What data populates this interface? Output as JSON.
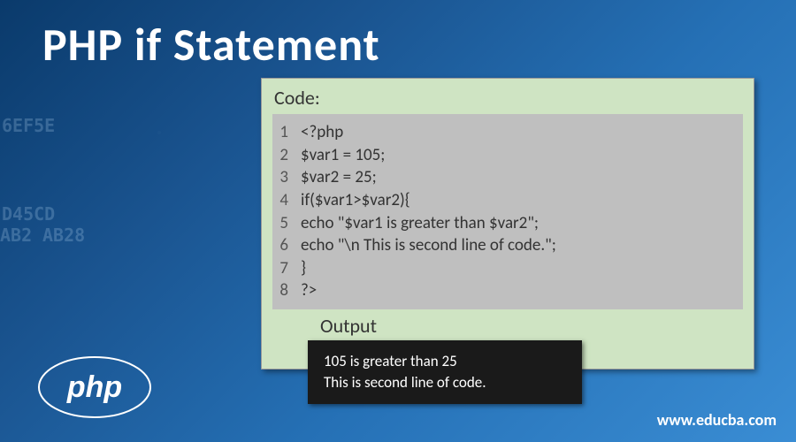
{
  "title": "PHP if Statement",
  "code_label": "Code:",
  "code_lines": [
    "<?php",
    "$var1 = 105;",
    "$var2 = 25;",
    "if($var1>$var2){",
    "echo \"$var1 is greater than $var2\";",
    "echo \"\\n This is second line of code.\";",
    "}",
    "?>"
  ],
  "output_label": "Output",
  "output_lines": [
    "105 is greater than 25",
    "This is second line of code."
  ],
  "logo_text": "php",
  "website": "www.educba.com",
  "bg_hex": [
    "D45CD",
    "AB2",
    "AB28",
    "6EF5E"
  ]
}
